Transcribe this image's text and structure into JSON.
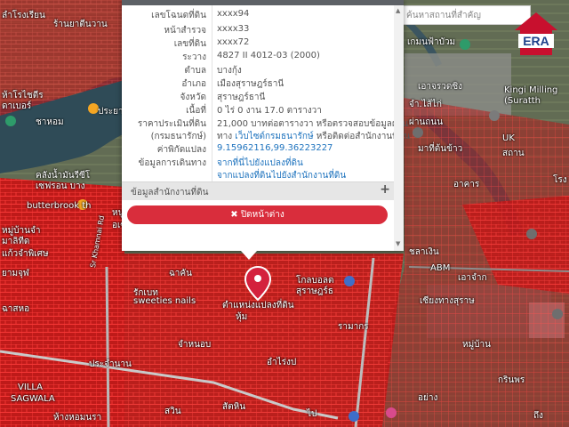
{
  "popup": {
    "rows": [
      {
        "label": "เลขโฉนดที่ดิน",
        "value": "xxxx94"
      },
      {
        "label": "หน้าสำรวจ",
        "value": "xxxx33"
      },
      {
        "label": "เลขที่ดิน",
        "value": "xxxx72"
      },
      {
        "label": "ระวาง",
        "value": "4827 II 4012-03 (2000)"
      },
      {
        "label": "ตำบล",
        "value": "บางกุ้ง"
      },
      {
        "label": "อำเภอ",
        "value": "เมืองสุราษฎร์ธานี"
      },
      {
        "label": "จังหวัด",
        "value": "สุราษฎร์ธานี"
      },
      {
        "label": "เนื้อที่",
        "value": "0 ไร่ 0 งาน 17.0 ตารางวา"
      }
    ],
    "price_label_1": "ราคาประเมินที่ดิน",
    "price_label_2": "(กรมธนารักษ์)",
    "price_value_1": "21,000 บาทต่อตารางวา หรือตรวจสอบข้อมูลผ่าน",
    "price_value_2a": "ทาง ",
    "price_value_2b": "เว็บไซต์กรมธนารักษ์",
    "price_value_2c": " หรือติดต่อสำนักงานที่ดิน",
    "coord_label": "ค่าพิกัดแปลง",
    "coord_value": "9.15962116,99.36223227",
    "travel_label": "ข้อมูลการเดินทาง",
    "travel_link_1": "จากที่นี่ไปยังแปลงที่ดิน",
    "travel_link_2": "จากแปลงที่ดินไปยังสำนักงานที่ดิน",
    "office_section": "ข้อมูลสำนักงานที่ดิน",
    "expand_glyph": "+",
    "close_button": "✖ ปิดหน้าต่าง"
  },
  "search": {
    "placeholder": "ค้นหาสถานที่สำคัญ"
  },
  "logo": {
    "text": "ERA",
    "color": "#c8102e"
  },
  "map_labels": [
    "ลำโรงเรียน",
    "ร้านยาตีนวาน",
    "ห้าโรไชตีร",
    "ดาเบอร์",
    "ชาหอม",
    "ประยา",
    "เกมนฟ้าบัวม",
    "เอาจรวดซิง",
    "จำ.ไส้ไก่",
    "Kingi Milling",
    "(Suratth",
    "ผ่านถนน",
    "มาที่ต้นข้าว",
    "UK",
    "สถาน",
    "คลังน้ำมันรีซีโ",
    "เซฟรอน บาง",
    "butterbrook th",
    "หมู่บ้านจำ",
    "มาลิทีด",
    "แก้วจำพิเศษ",
    "หนู",
    "อเซน",
    "ชลาเงิน",
    "ABM",
    "เอาจำก",
    "โกลบอลต",
    "สุราษฎร์ธ",
    "sweeties nails",
    "ตำแหน่งแปลงที่ดิน",
    "หุ้ม",
    "เซียงทางสุราษ",
    "VILLA",
    "SAGWALA",
    "ประจำนาน",
    "ห้างหอมนรา",
    "Sr Khamnai Rd",
    "รักเบท",
    "โรง",
    "ยามจุฬ",
    "ฉาคัน",
    "ฉาสหอ",
    "จำหนอบ",
    "อำไร่งป",
    "อาคาร",
    "กรินพร",
    "อย่าง",
    "สัตหิน",
    "ไป",
    "สวิน",
    "รามากร",
    "หมู่บ้าน",
    "ถึง"
  ]
}
